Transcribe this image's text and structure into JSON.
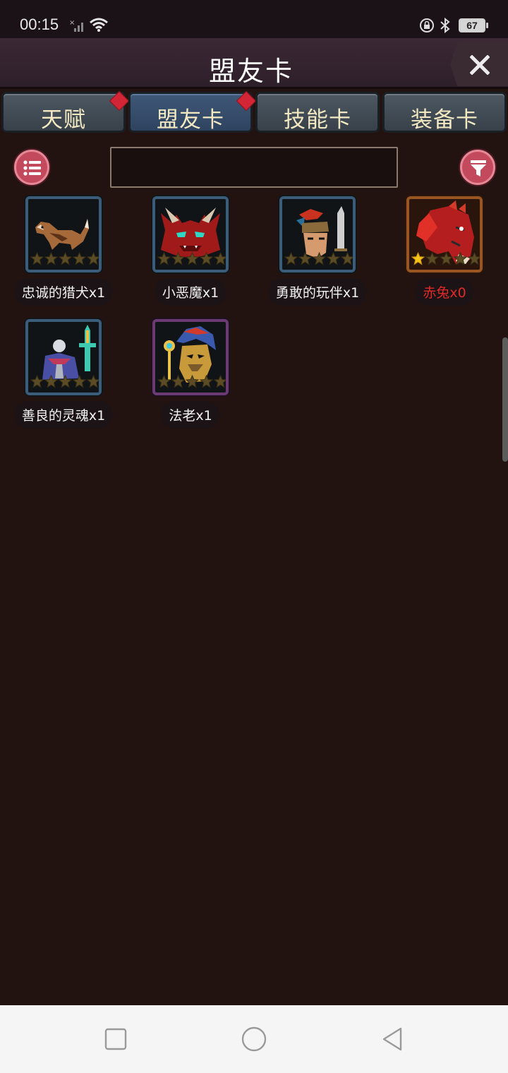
{
  "status": {
    "time": "00:15",
    "battery": "67"
  },
  "header": {
    "title": "盟友卡"
  },
  "tabs": [
    {
      "label": "天赋",
      "badge": true,
      "active": false
    },
    {
      "label": "盟友卡",
      "badge": true,
      "active": true
    },
    {
      "label": "技能卡",
      "badge": false,
      "active": false
    },
    {
      "label": "装备卡",
      "badge": false,
      "active": false
    }
  ],
  "search": {
    "value": "",
    "placeholder": ""
  },
  "cards": [
    {
      "name": "忠诚的猎犬x1",
      "stars": 0,
      "rarity": "blue",
      "icon": "hound-portrait-icon"
    },
    {
      "name": "小恶魔x1",
      "stars": 0,
      "rarity": "blue",
      "icon": "imp-portrait-icon"
    },
    {
      "name": "勇敢的玩伴x1",
      "stars": 0,
      "rarity": "blue",
      "icon": "warrior-portrait-icon"
    },
    {
      "name": "赤兔x0",
      "stars": 1,
      "rarity": "gold",
      "icon": "red-horse-portrait-icon",
      "color": "#e02a26"
    },
    {
      "name": "善良的灵魂x1",
      "stars": 0,
      "rarity": "blue",
      "icon": "spirit-portrait-icon"
    },
    {
      "name": "法老x1",
      "stars": 0,
      "rarity": "purple",
      "icon": "pharaoh-portrait-icon"
    }
  ],
  "colors": {
    "background": "#231310",
    "accent_button": "#c24a5c",
    "badge": "#d22535",
    "unowned_name": "#e02a26"
  }
}
